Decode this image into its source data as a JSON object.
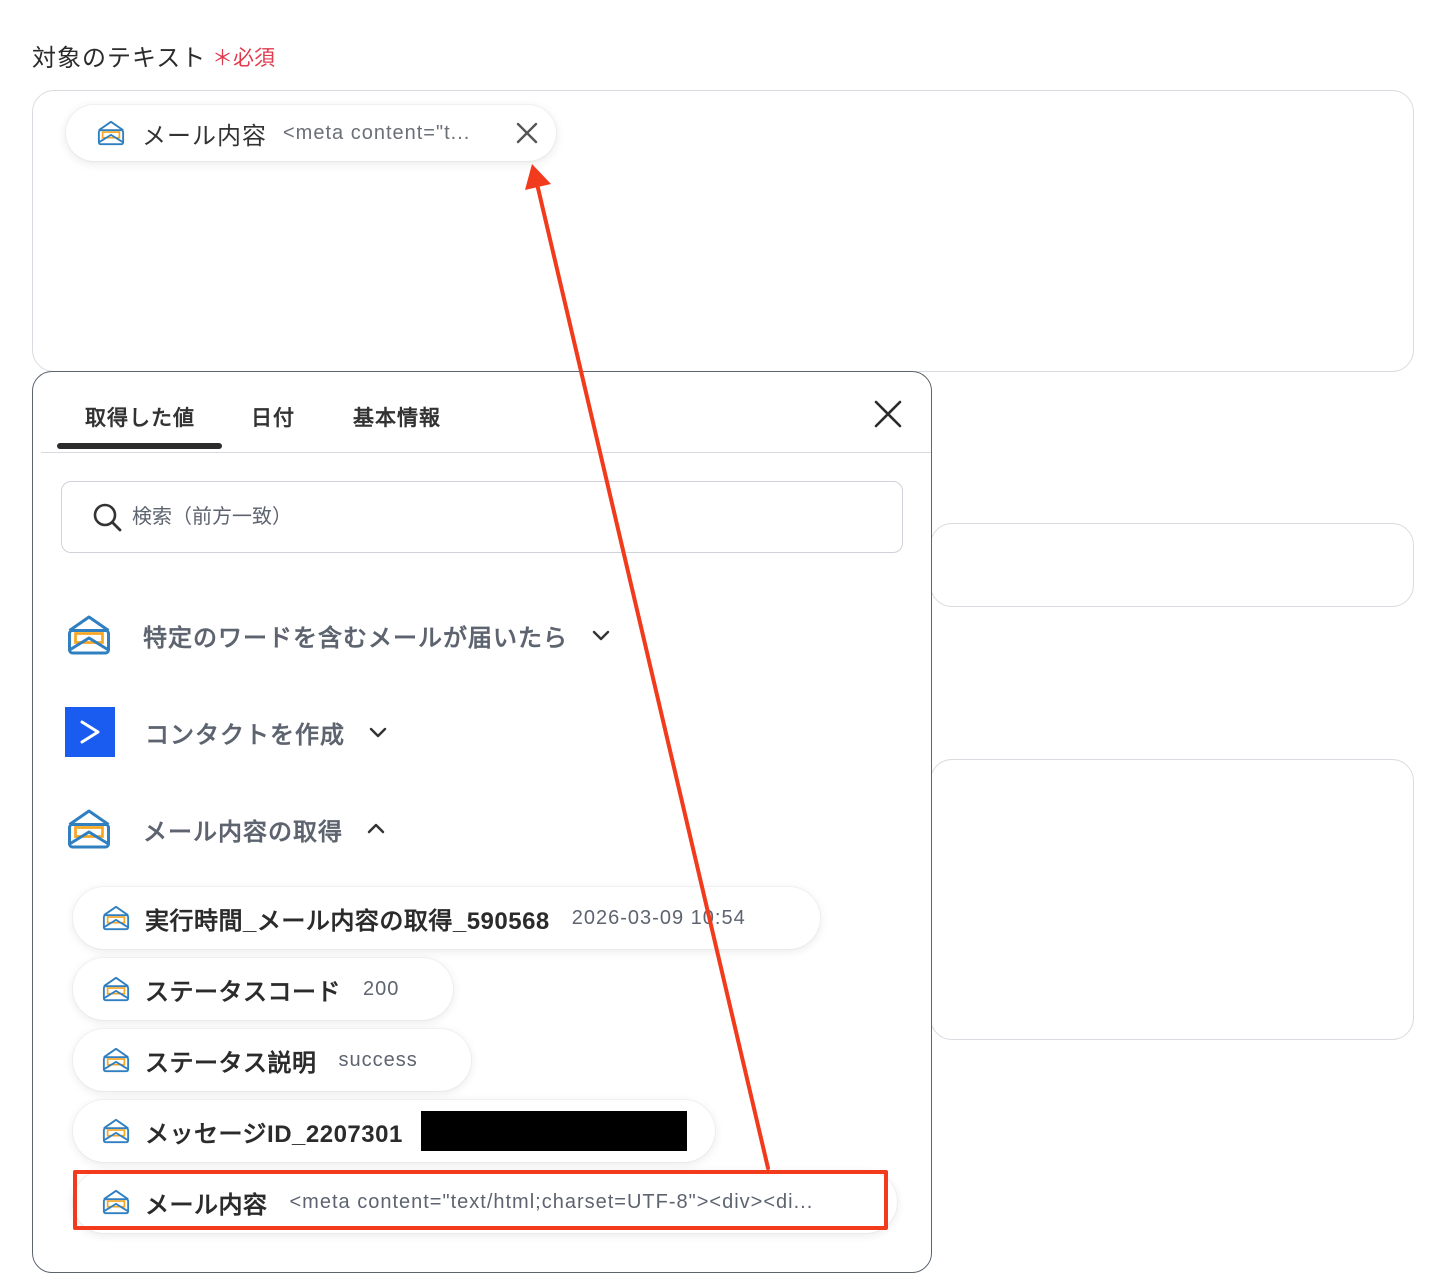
{
  "field": {
    "label": "対象のテキスト",
    "required_mark": "＊必須"
  },
  "selected_chip": {
    "name": "メール内容",
    "value": "<meta content=\"t...",
    "icon": "mail-open-icon"
  },
  "panel": {
    "tabs": [
      {
        "label": "取得した値",
        "active": true
      },
      {
        "label": "日付",
        "active": false
      },
      {
        "label": "基本情報",
        "active": false
      }
    ],
    "search_placeholder": "検索（前方一致）",
    "groups": [
      {
        "title": "特定のワードを含むメールが届いたら",
        "icon": "mail-open-icon",
        "expanded": false
      },
      {
        "title": "コンタクトを作成",
        "icon": "activecampaign-icon",
        "expanded": false
      },
      {
        "title": "メール内容の取得",
        "icon": "mail-open-icon",
        "expanded": true
      }
    ],
    "items": [
      {
        "name": "実行時間_メール内容の取得_590568",
        "value": "2026-03-09 10:54"
      },
      {
        "name": "ステータスコード",
        "value": "200"
      },
      {
        "name": "ステータス説明",
        "value": "success"
      },
      {
        "name": "メッセージID_2207301",
        "value": ""
      },
      {
        "name": "メール内容",
        "value": "<meta content=\"text/html;charset=UTF-8\"><div><di..."
      }
    ]
  },
  "colors": {
    "required": "#e03b4f",
    "annotation": "#f23a1d",
    "activecampaign": "#1a5cf0",
    "mail_blue": "#2f7fc1",
    "mail_orange": "#f5a623"
  }
}
